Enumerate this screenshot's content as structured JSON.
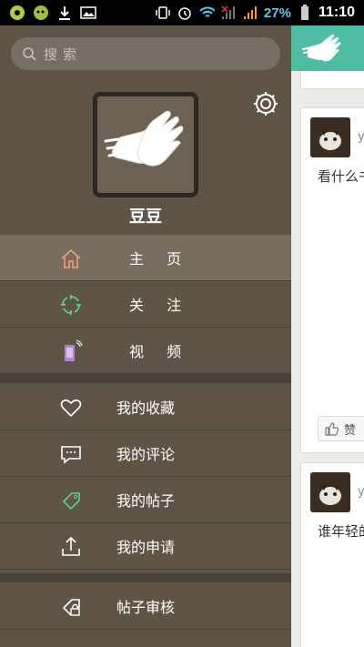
{
  "status_bar": {
    "battery_percent": "27%",
    "time": "11:10"
  },
  "drawer": {
    "search_placeholder": "搜索",
    "username": "豆豆",
    "menu": [
      {
        "label": "主 页",
        "icon": "home-icon",
        "active": true
      },
      {
        "label": "关 注",
        "icon": "target-icon"
      },
      {
        "label": "视 频",
        "icon": "phone-video-icon"
      },
      {
        "label": "我的收藏",
        "icon": "heart-icon"
      },
      {
        "label": "我的评论",
        "icon": "comment-icon"
      },
      {
        "label": "我的帖子",
        "icon": "tag-icon"
      },
      {
        "label": "我的申请",
        "icon": "upload-icon"
      },
      {
        "label": "帖子审核",
        "icon": "lock-tag-icon"
      }
    ]
  },
  "main": {
    "cards": [
      {
        "text": "看什么书",
        "user_initial": "y"
      },
      {
        "text": "谁年轻的",
        "user_initial": "y"
      }
    ],
    "like_label": "赞"
  },
  "colors": {
    "drawer_bg": "#5e5546",
    "accent": "#4fbca4",
    "home_icon": "#e79a6b",
    "follow_icon": "#5fd1a0",
    "video_icon": "#b382d8"
  }
}
